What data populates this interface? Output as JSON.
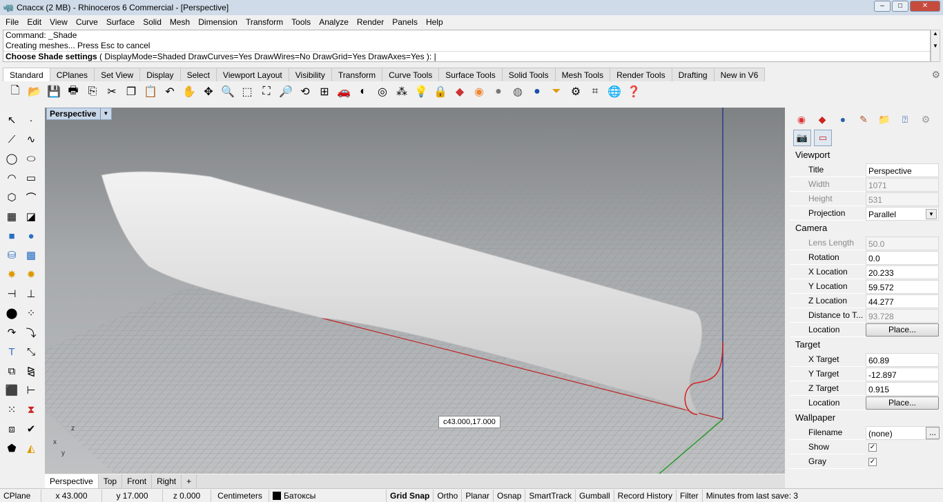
{
  "window": {
    "title": "Спасск (2 MB) - Rhinoceros 6 Commercial - [Perspective]",
    "min": "–",
    "max": "□",
    "close": "✕"
  },
  "menu": [
    "File",
    "Edit",
    "View",
    "Curve",
    "Surface",
    "Solid",
    "Mesh",
    "Dimension",
    "Transform",
    "Tools",
    "Analyze",
    "Render",
    "Panels",
    "Help"
  ],
  "command": {
    "line1": "Command: _Shade",
    "line2": "Creating meshes... Press Esc to cancel",
    "prompt_bold": "Choose Shade settings",
    "prompt_rest": " ( DisplayMode=Shaded  DrawCurves=Yes  DrawWires=No  DrawGrid=Yes  DrawAxes=Yes ): "
  },
  "tabs": [
    "Standard",
    "CPlanes",
    "Set View",
    "Display",
    "Select",
    "Viewport Layout",
    "Visibility",
    "Transform",
    "Curve Tools",
    "Surface Tools",
    "Solid Tools",
    "Mesh Tools",
    "Render Tools",
    "Drafting",
    "New in V6"
  ],
  "toolbar_icons": [
    "new-icon",
    "open-icon",
    "save-icon",
    "print-icon",
    "import-icon",
    "cut-icon",
    "copy-icon",
    "paste-icon",
    "undo-icon",
    "pan-icon",
    "rotate-icon",
    "zoom-icon",
    "zoom-window-icon",
    "zoom-extents-icon",
    "zoom-selected-icon",
    "undo-view-icon",
    "four-viewports-icon",
    "car-icon",
    "shade-icon",
    "osnap-icon",
    "properties-icon",
    "light-icon",
    "lock-icon",
    "material-icon",
    "color-icon",
    "sphere-icon",
    "rendered-icon",
    "render-icon",
    "filter-icon",
    "options-icon",
    "gumball-icon",
    "globe-icon",
    "help-icon"
  ],
  "viewport": {
    "name": "Perspective",
    "coord_tip": "c43.000,17.000",
    "axis_z": "z",
    "axis_x": "x",
    "axis_y": "y"
  },
  "viewport_tabs": [
    "Perspective",
    "Top",
    "Front",
    "Right",
    "+"
  ],
  "status": {
    "cplane": "CPlane",
    "x": "x 43.000",
    "y": "y 17.000",
    "z": "z 0.000",
    "units": "Centimeters",
    "layer": "Батоксы",
    "grid_snap": "Grid Snap",
    "ortho": "Ortho",
    "planar": "Planar",
    "osnap": "Osnap",
    "smarttrack": "SmartTrack",
    "gumball": "Gumball",
    "record_history": "Record History",
    "filter": "Filter",
    "minutes": "Minutes from last save: 3"
  },
  "panel": {
    "viewport_header": "Viewport",
    "title_label": "Title",
    "title_value": "Perspective",
    "width_label": "Width",
    "width_value": "1071",
    "height_label": "Height",
    "height_value": "531",
    "projection_label": "Projection",
    "projection_value": "Parallel",
    "camera_header": "Camera",
    "lens_label": "Lens Length",
    "lens_value": "50.0",
    "rotation_label": "Rotation",
    "rotation_value": "0.0",
    "xloc_label": "X Location",
    "xloc_value": "20.233",
    "yloc_label": "Y Location",
    "yloc_value": "59.572",
    "zloc_label": "Z Location",
    "zloc_value": "44.277",
    "dist_label": "Distance to T...",
    "dist_value": "93.728",
    "location_label": "Location",
    "place_button": "Place...",
    "target_header": "Target",
    "xt_label": "X Target",
    "xt_value": "60.89",
    "yt_label": "Y Target",
    "yt_value": "-12.897",
    "zt_label": "Z Target",
    "zt_value": "0.915",
    "tlocation_label": "Location",
    "tplace_button": "Place...",
    "wallpaper_header": "Wallpaper",
    "filename_label": "Filename",
    "filename_value": "(none)",
    "filename_browse": "...",
    "show_label": "Show",
    "show_checked": "✓",
    "gray_label": "Gray",
    "gray_checked": "✓"
  }
}
